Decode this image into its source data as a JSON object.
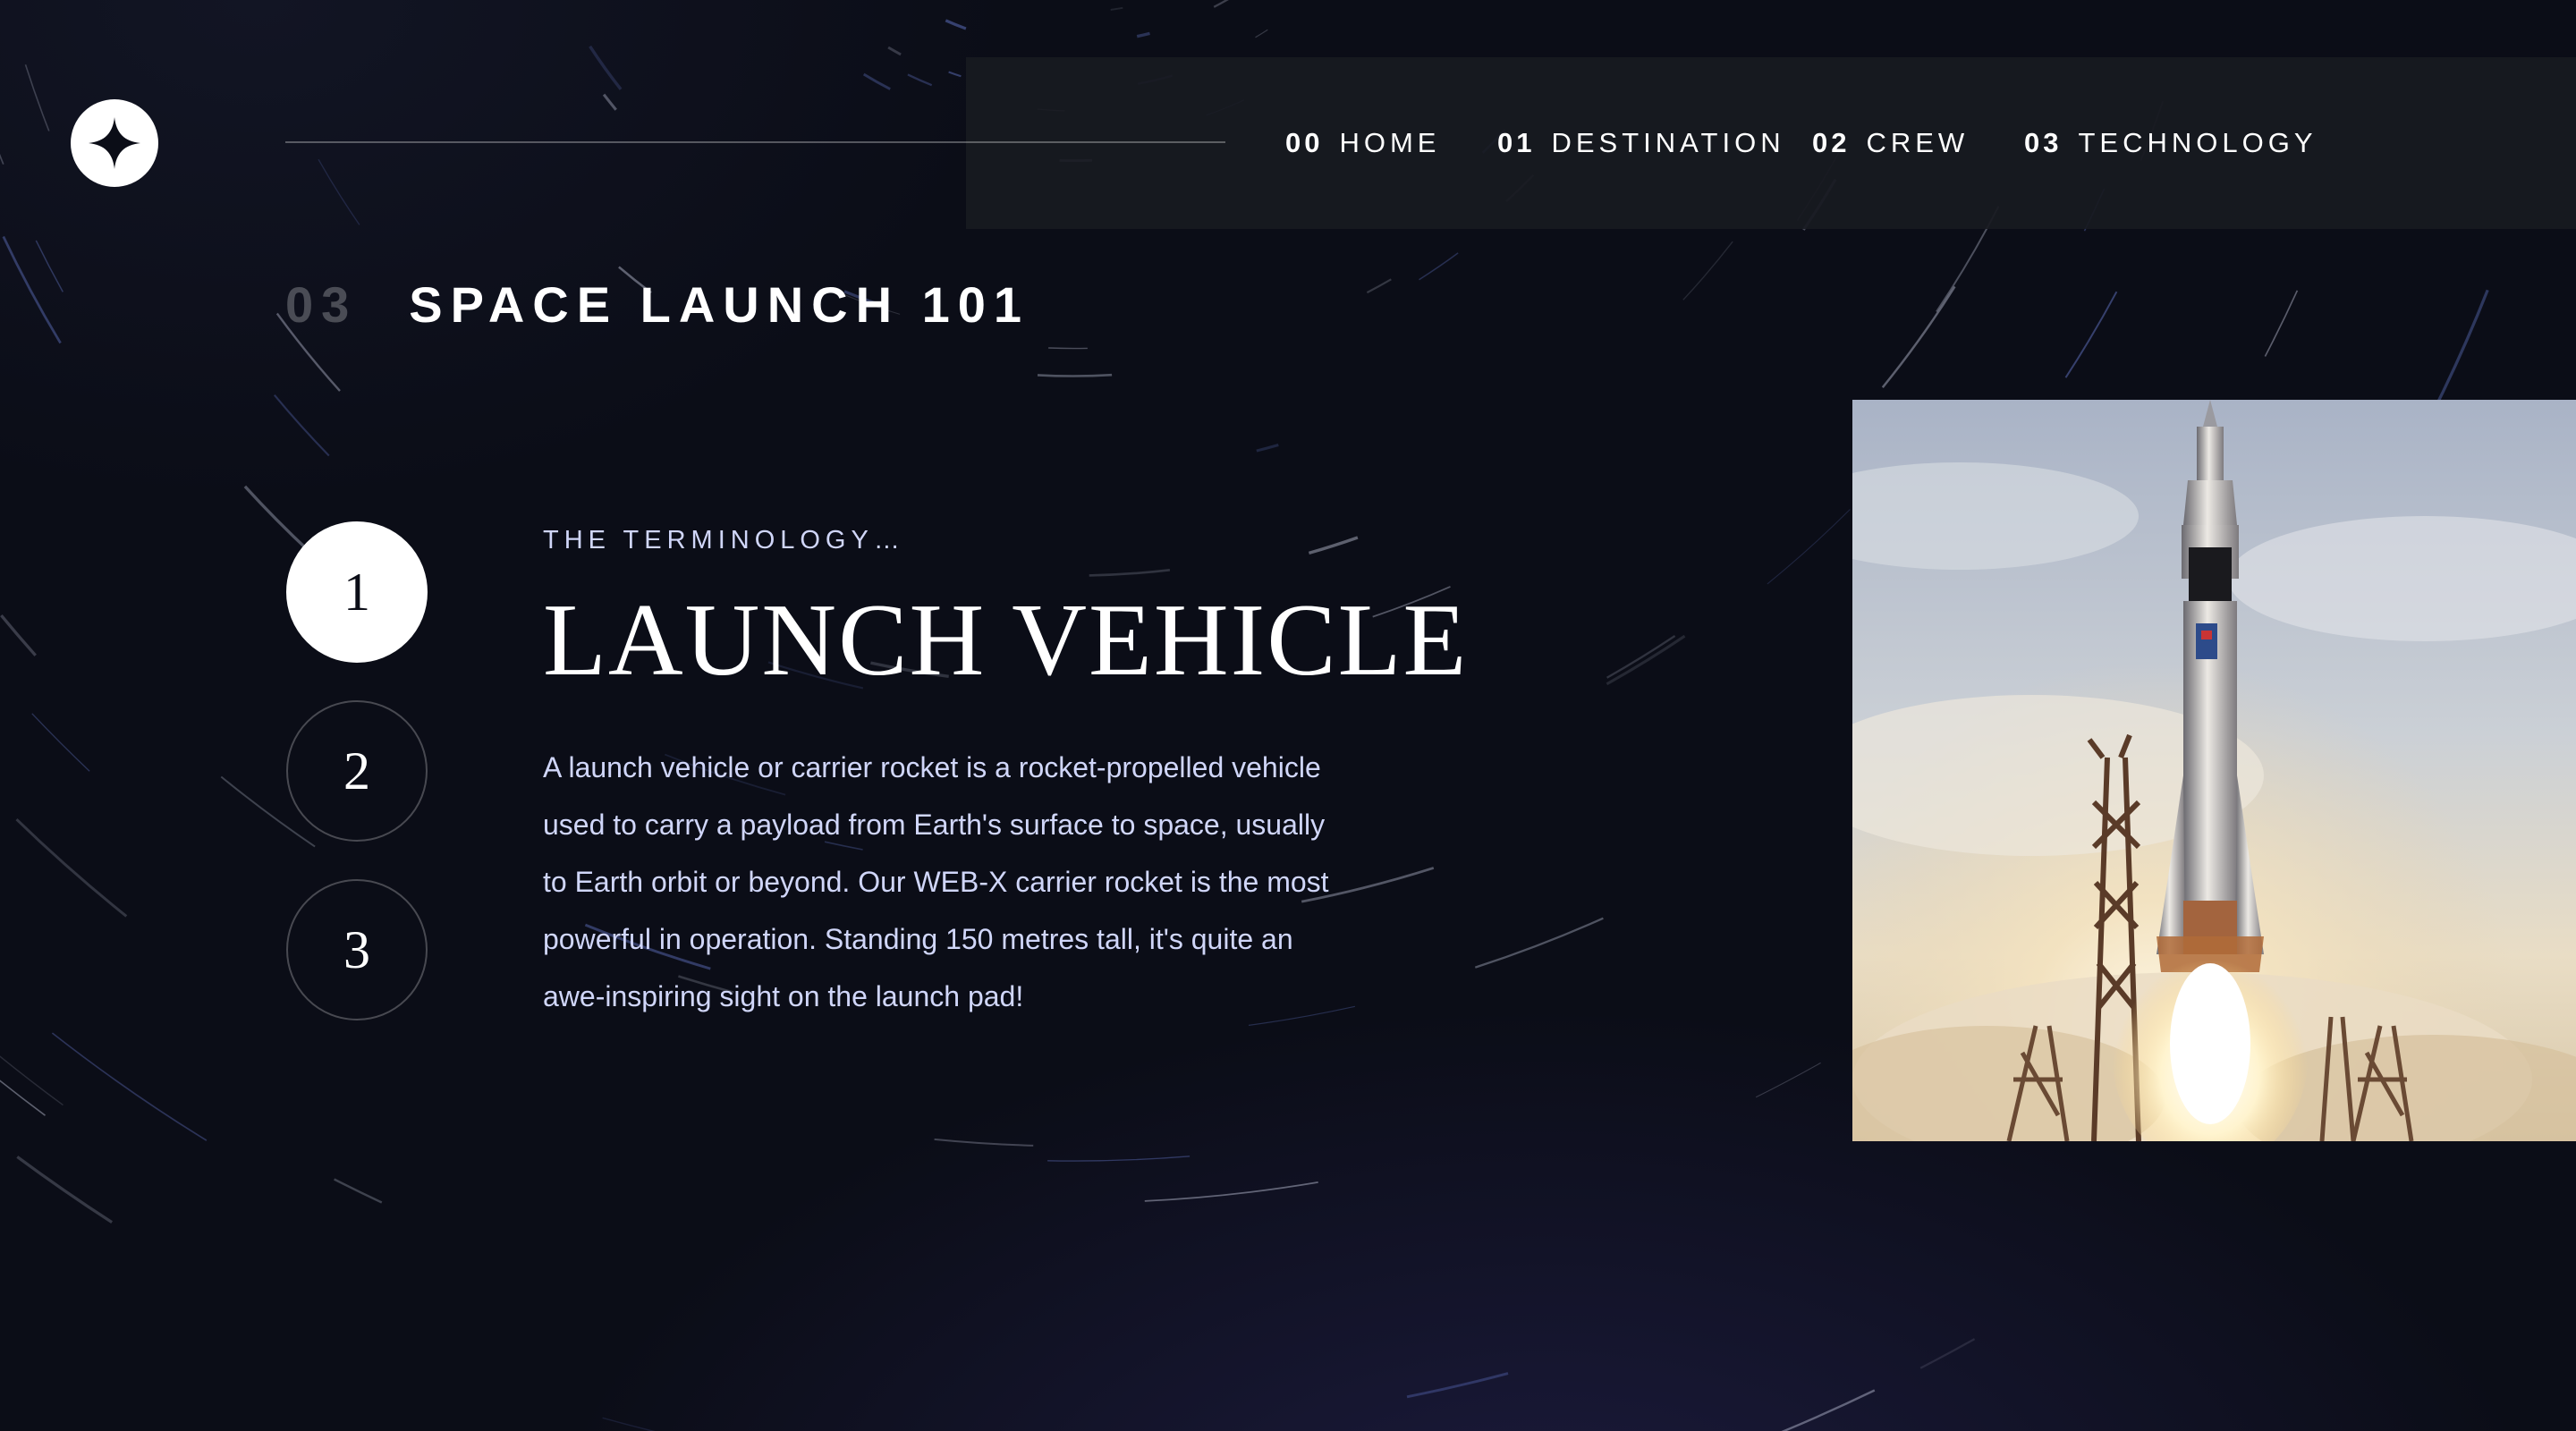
{
  "nav": {
    "items": [
      {
        "num": "00",
        "label": "HOME"
      },
      {
        "num": "01",
        "label": "DESTINATION"
      },
      {
        "num": "02",
        "label": "CREW"
      },
      {
        "num": "03",
        "label": "TECHNOLOGY"
      }
    ]
  },
  "page": {
    "number": "03",
    "title": "SPACE LAUNCH 101"
  },
  "steps": [
    "1",
    "2",
    "3"
  ],
  "active_step": "1",
  "content": {
    "eyebrow": "THE TERMINOLOGY…",
    "headline": "LAUNCH VEHICLE",
    "body": "A launch vehicle or carrier rocket is a rocket-propelled vehicle used to carry a payload from Earth's surface to space, usually to Earth orbit or beyond. Our WEB-X carrier rocket is the most powerful in operation. Standing 150 metres tall, it's quite an awe-inspiring sight on the launch pad!"
  },
  "icons": {
    "logo": "four-point-star-icon"
  },
  "colors": {
    "background": "#0b0d17",
    "accent_text": "#d0d6f9",
    "nav_bg": "#181a21",
    "white": "#ffffff"
  }
}
